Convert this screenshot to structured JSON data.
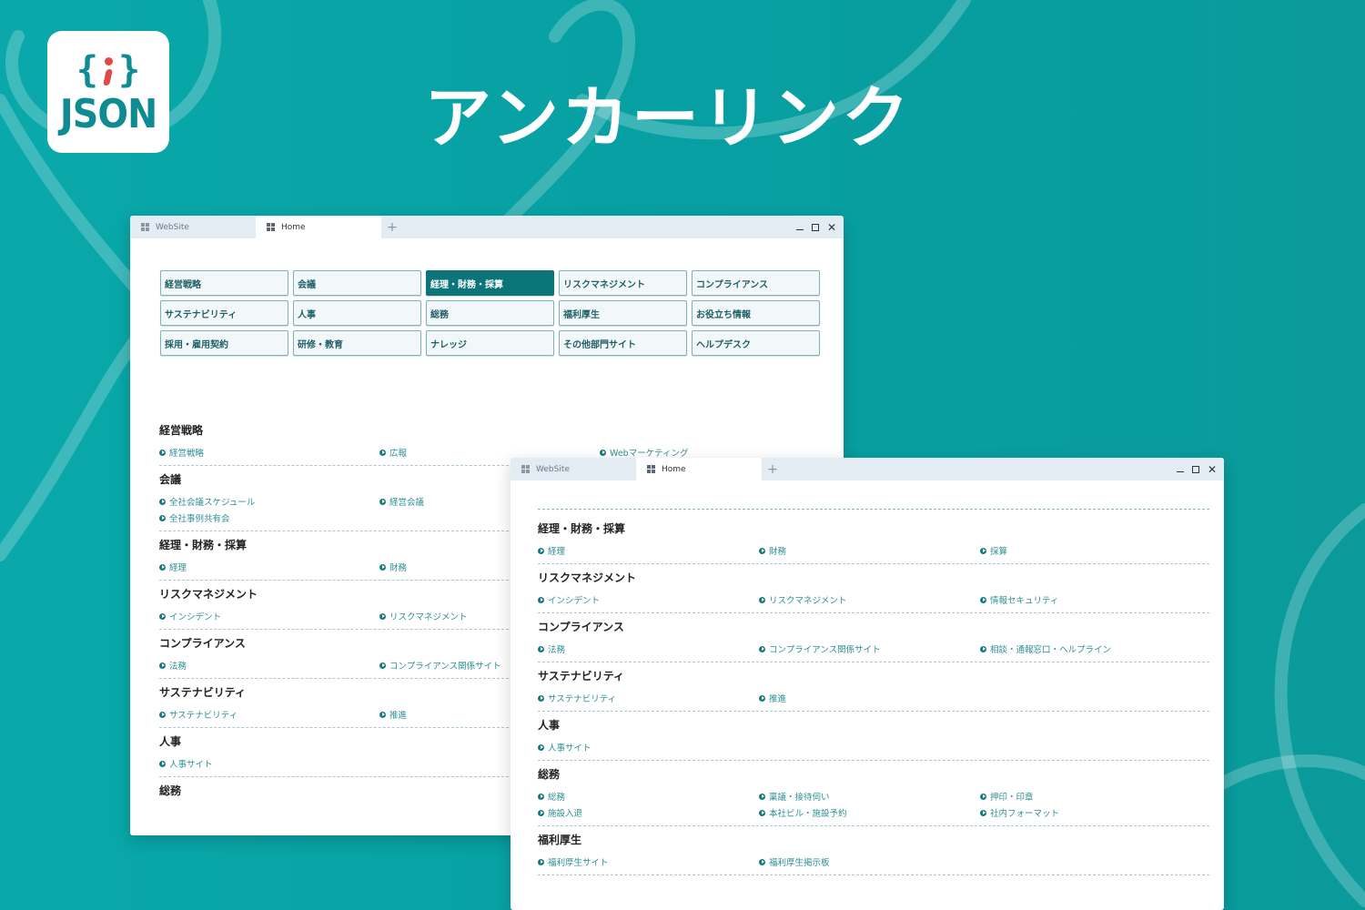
{
  "logo": {
    "glyph_left": "{",
    "glyph_right": "}",
    "word": "JSON"
  },
  "page_title": "アンカーリンク",
  "colors": {
    "background": "#08a3a5",
    "accent": "#0c757a",
    "link": "#2e8f95"
  },
  "window1": {
    "tabs": [
      {
        "label": "WebSite"
      },
      {
        "label": "Home"
      }
    ],
    "new_tab": "+",
    "nav": [
      {
        "label": "経営戦略"
      },
      {
        "label": "会議"
      },
      {
        "label": "経理・財務・採算",
        "active": true
      },
      {
        "label": "リスクマネジメント"
      },
      {
        "label": "コンプライアンス"
      },
      {
        "label": "サステナビリティ"
      },
      {
        "label": "人事"
      },
      {
        "label": "総務"
      },
      {
        "label": "福利厚生"
      },
      {
        "label": "お役立ち情報"
      },
      {
        "label": "採用・雇用契約"
      },
      {
        "label": "研修・教育"
      },
      {
        "label": "ナレッジ"
      },
      {
        "label": "その他部門サイト"
      },
      {
        "label": "ヘルプデスク"
      }
    ],
    "sections": [
      {
        "title": "経営戦略",
        "links": [
          "経営戦略",
          "広報",
          "Webマーケティング"
        ]
      },
      {
        "title": "会議",
        "links": [
          "全社会議スケジュール",
          "経営会議",
          "",
          "全社事例共有会"
        ]
      },
      {
        "title": "経理・財務・採算",
        "links": [
          "経理",
          "財務"
        ]
      },
      {
        "title": "リスクマネジメント",
        "links": [
          "インシデント",
          "リスクマネジメント"
        ]
      },
      {
        "title": "コンプライアンス",
        "links": [
          "法務",
          "コンプライアンス関係サイト"
        ]
      },
      {
        "title": "サステナビリティ",
        "links": [
          "サステナビリティ",
          "推進"
        ]
      },
      {
        "title": "人事",
        "links": [
          "人事サイト"
        ]
      },
      {
        "title": "総務",
        "links": []
      }
    ]
  },
  "window2": {
    "tabs": [
      {
        "label": "WebSite"
      },
      {
        "label": "Home"
      }
    ],
    "new_tab": "+",
    "sections": [
      {
        "title": "経理・財務・採算",
        "links": [
          "経理",
          "財務",
          "採算"
        ]
      },
      {
        "title": "リスクマネジメント",
        "links": [
          "インシデント",
          "リスクマネジメント",
          "情報セキュリティ"
        ]
      },
      {
        "title": "コンプライアンス",
        "links": [
          "法務",
          "コンプライアンス関係サイト",
          "相談・通報窓口・ヘルプライン"
        ]
      },
      {
        "title": "サステナビリティ",
        "links": [
          "サステナビリティ",
          "推進"
        ]
      },
      {
        "title": "人事",
        "links": [
          "人事サイト"
        ]
      },
      {
        "title": "総務",
        "links": [
          "総務",
          "稟議・接待伺い",
          "押印・印章",
          "施設入退",
          "本社ビル・施設予約",
          "社内フォーマット"
        ]
      },
      {
        "title": "福利厚生",
        "links": [
          "福利厚生サイト",
          "福利厚生掲示板"
        ]
      }
    ]
  }
}
